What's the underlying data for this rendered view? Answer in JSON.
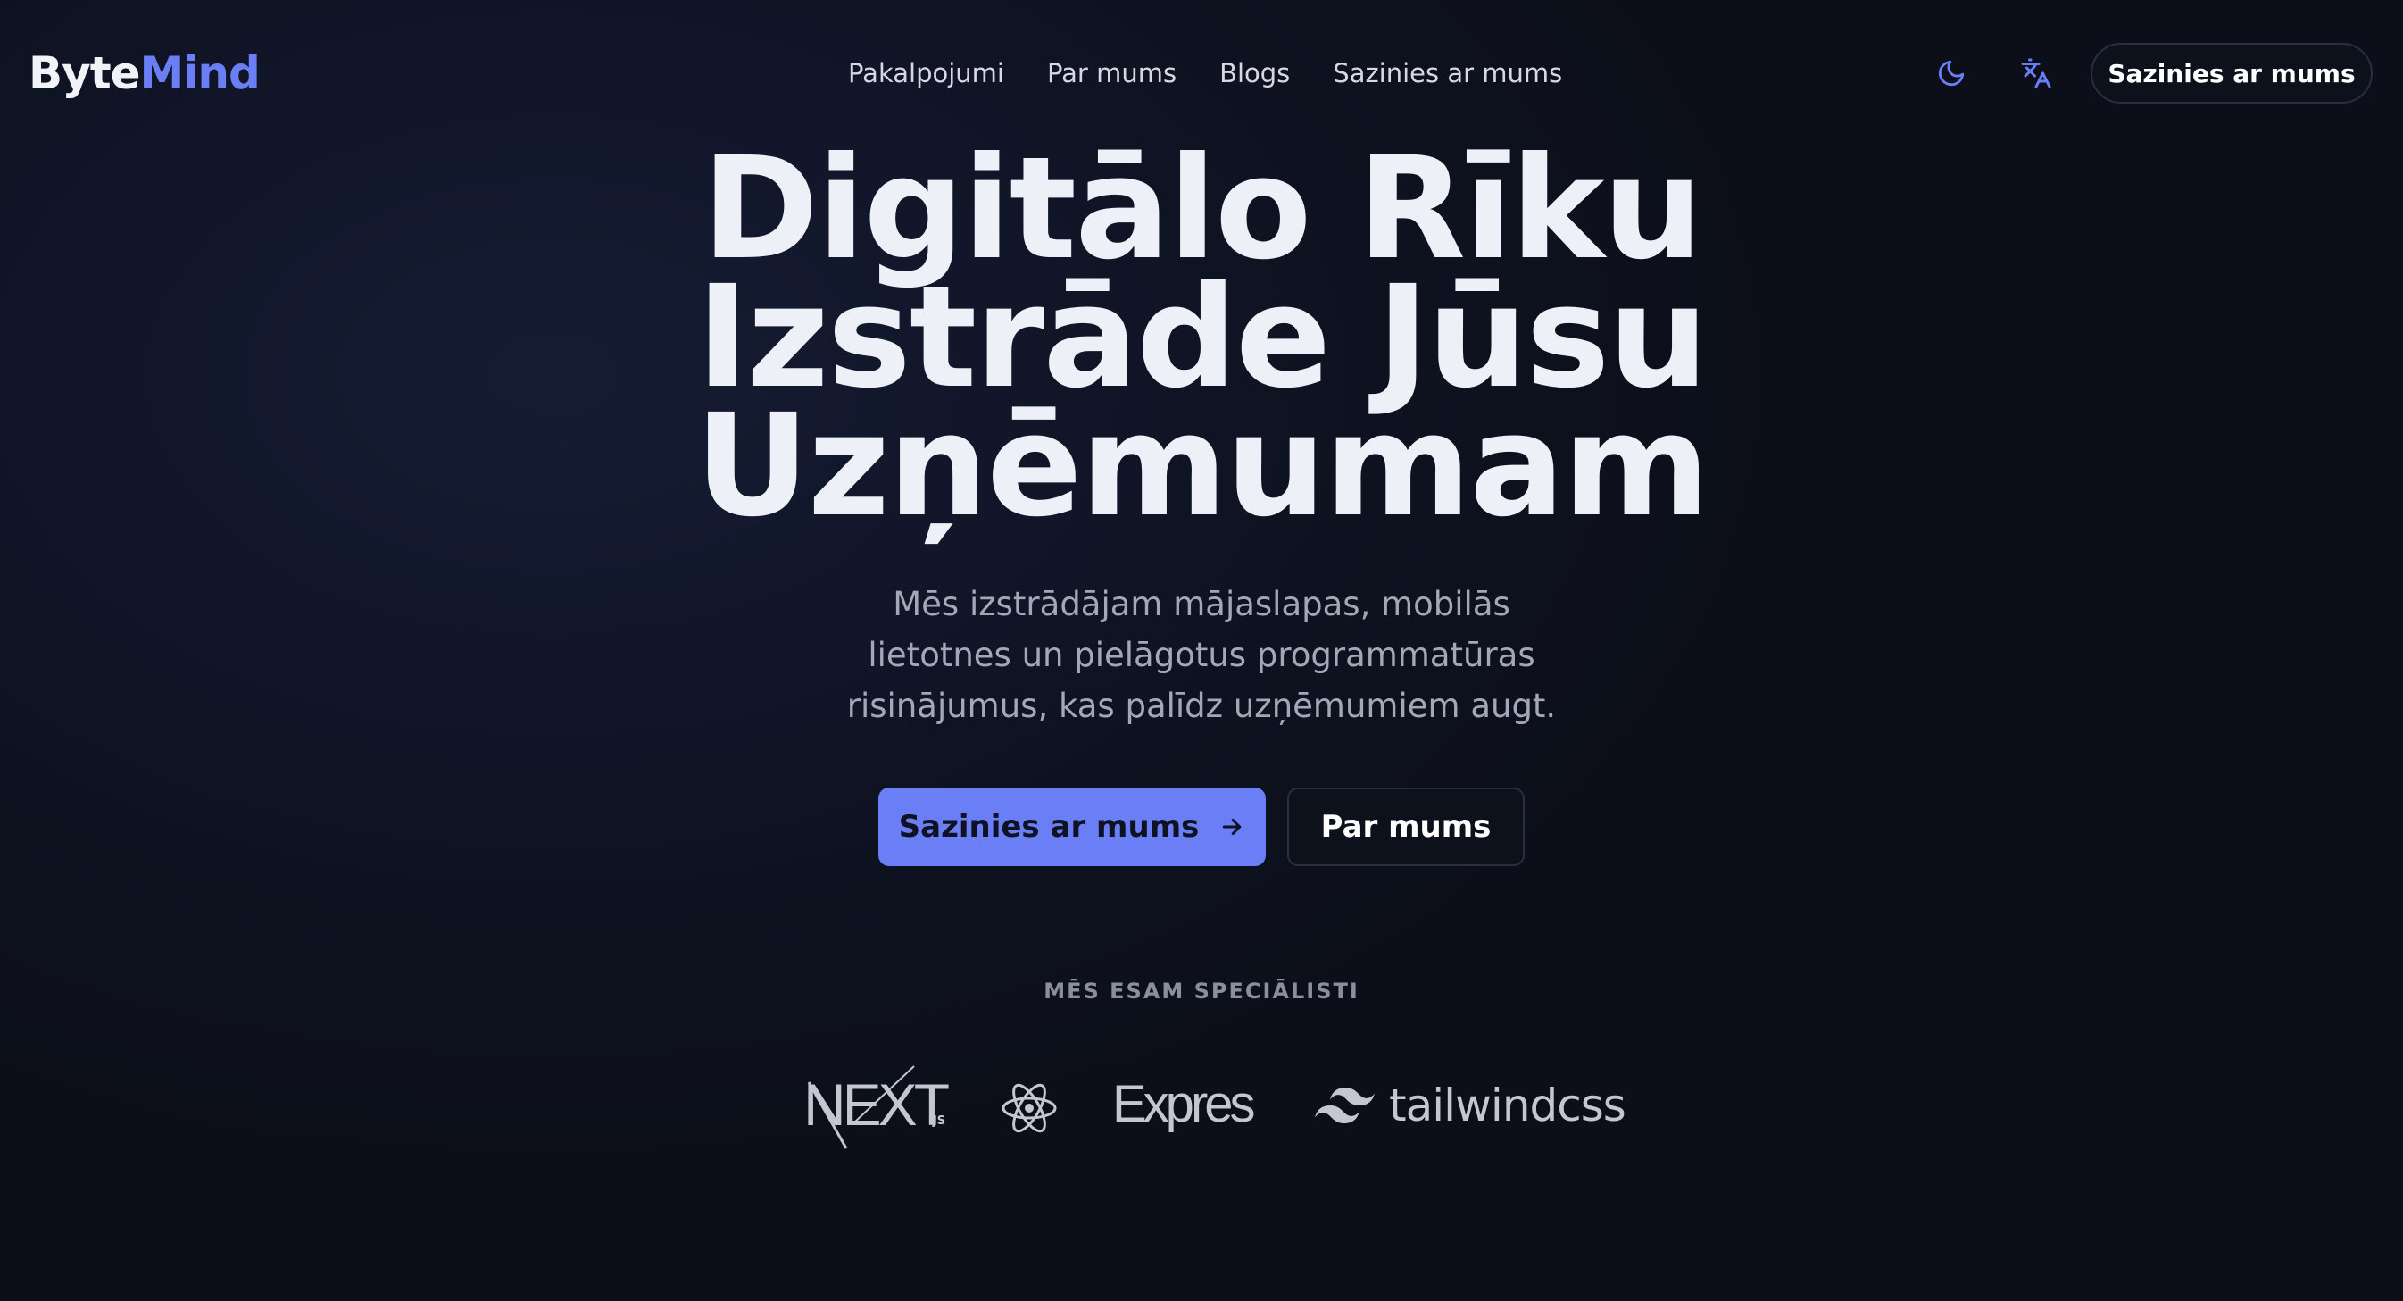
{
  "brand": {
    "part1": "Byte",
    "part2": "Mind",
    "color_primary": "#6a7ff5"
  },
  "nav": {
    "items": [
      {
        "label": "Pakalpojumi"
      },
      {
        "label": "Par mums"
      },
      {
        "label": "Blogs"
      },
      {
        "label": "Sazinies ar mums"
      }
    ]
  },
  "header": {
    "theme_icon": "moon-icon",
    "language_icon": "translate-icon",
    "cta_label": "Sazinies ar mums"
  },
  "hero": {
    "title_line1": "Digitālo Rīku",
    "title_line2": "Izstrāde Jūsu",
    "title_line3": "Uzņēmumam",
    "subtitle_line1": "Mēs izstrādājam mājaslapas, mobilās",
    "subtitle_line2": "lietotnes un pielāgotus programmatūras",
    "subtitle_line3": "risinājumus, kas palīdz uzņēmumiem augt.",
    "primary_button": "Sazinies ar mums",
    "primary_button_icon": "arrow-right-icon",
    "secondary_button": "Par mums"
  },
  "specialists": {
    "heading": "MĒS ESAM SPECIĀLISTI",
    "next_text": "NEXT",
    "next_suffix": ".JS",
    "express_text": "Expres",
    "tailwind_text": "tailwindcss",
    "icons": [
      "nextjs-logo",
      "react-icon",
      "express-logo",
      "tailwind-icon"
    ]
  }
}
